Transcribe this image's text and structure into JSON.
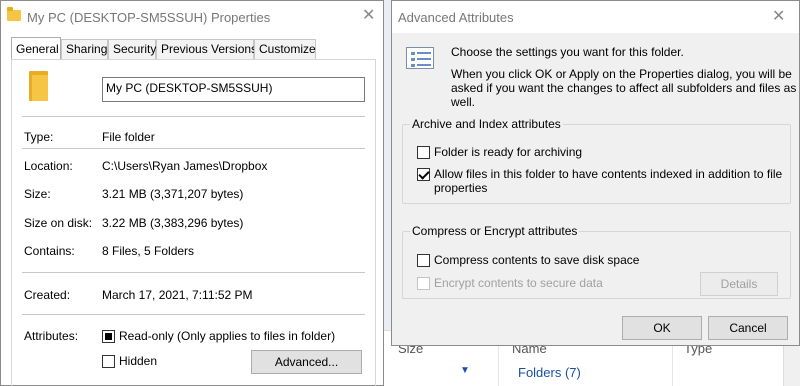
{
  "properties": {
    "title": "My PC (DESKTOP-SM5SSUH) Properties",
    "close_glyph": "✕",
    "tabs": [
      "General",
      "Sharing",
      "Security",
      "Previous Versions",
      "Customize"
    ],
    "name_value": "My PC (DESKTOP-SM5SSUH)",
    "rows": {
      "type": {
        "label": "Type:",
        "value": "File folder"
      },
      "location": {
        "label": "Location:",
        "value": "C:\\Users\\Ryan James\\Dropbox"
      },
      "size": {
        "label": "Size:",
        "value": "3.21 MB (3,371,207 bytes)"
      },
      "size_on_disk": {
        "label": "Size on disk:",
        "value": "3.22 MB (3,383,296 bytes)"
      },
      "contains": {
        "label": "Contains:",
        "value": "8 Files, 5 Folders"
      },
      "created": {
        "label": "Created:",
        "value": "March 17, 2021, 7:11:52 PM"
      }
    },
    "attributes": {
      "label": "Attributes:",
      "readonly_label": "Read-only (Only applies to files in folder)",
      "readonly_state": "indeterminate",
      "hidden_label": "Hidden",
      "hidden_checked": false,
      "advanced_button": "Advanced..."
    }
  },
  "advanced": {
    "title": "Advanced Attributes",
    "close_glyph": "✕",
    "intro_line1": "Choose the settings you want for this folder.",
    "intro_line2": "When you click OK or Apply on the Properties dialog, you will be",
    "intro_line3": "asked if you want the changes to affect all subfolders and files as",
    "intro_line4": "well.",
    "archive_group": {
      "title": "Archive and Index attributes",
      "archiving_label": "Folder is ready for archiving",
      "archiving_checked": false,
      "index_label_line1": "Allow files in this folder to have contents indexed in addition to file",
      "index_label_line2": "properties",
      "index_checked": true
    },
    "compress_group": {
      "title": "Compress or Encrypt attributes",
      "compress_label": "Compress contents to save disk space",
      "compress_checked": false,
      "encrypt_label": "Encrypt contents to secure data",
      "encrypt_enabled": false,
      "details_button": "Details"
    },
    "ok_button": "OK",
    "cancel_button": "Cancel"
  },
  "background": {
    "col_size": "Size",
    "col_name": "Name",
    "col_type": "Type",
    "folders_group": "Folders (7)"
  },
  "colors": {
    "folder_yellow": "#f6c543",
    "link_blue": "#1a4ea8",
    "dialog_bg": "#f0f0f0"
  }
}
